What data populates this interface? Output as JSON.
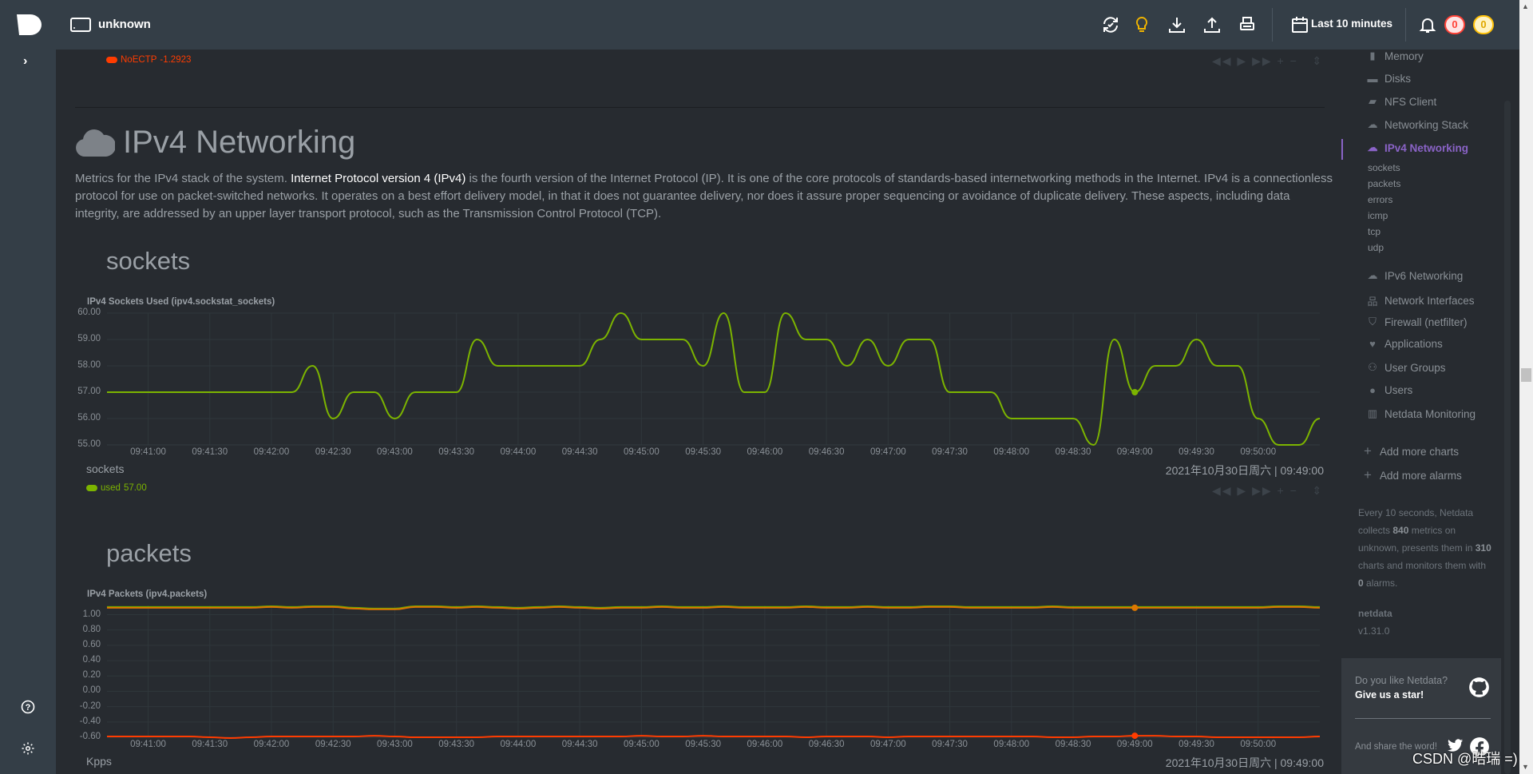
{
  "header": {
    "host": "unknown",
    "icons": [
      "netdata-logo",
      "server-icon",
      "refresh-icon",
      "lightbulb-icon",
      "download-icon",
      "upload-icon",
      "print-icon",
      "calendar-icon",
      "bell-icon"
    ],
    "time_range": "Last 10 minutes",
    "alarm_critical_count": "0",
    "alarm_warning_count": "0",
    "colors": {
      "bg": "#343e47",
      "critical": "#ff4136",
      "warning": "#ffc107"
    }
  },
  "prev_chart_legend": {
    "label": "NoECTP",
    "value": "-1.2923",
    "color": "#ff3c00"
  },
  "section": {
    "title": "IPv4 Networking",
    "icon": "cloud-icon",
    "desc_before": "Metrics for the IPv4 stack of the system. ",
    "desc_link": "Internet Protocol version 4 (IPv4)",
    "desc_after": " is the fourth version of the Internet Protocol (IP). It is one of the core protocols of standards-based internetworking methods in the Internet. IPv4 is a connectionless protocol for use on packet-switched networks. It operates on a best effort delivery model, in that it does not guarantee delivery, nor does it assure proper sequencing or avoidance of duplicate delivery. These aspects, including data integrity, are addressed by an upper layer transport protocol, such as the Transmission Control Protocol (TCP)."
  },
  "sockets_section": {
    "title": "sockets"
  },
  "packets_section": {
    "title": "packets"
  },
  "chart_data": [
    {
      "type": "line",
      "title": "IPv4 Sockets Used (ipv4.sockstat_sockets)",
      "ylabel": "sockets",
      "ylim": [
        55,
        60
      ],
      "yticks": [
        "60.00",
        "59.00",
        "58.00",
        "57.00",
        "56.00",
        "55.00"
      ],
      "xlim": [
        "09:40:40",
        "09:50:30"
      ],
      "xticks": [
        "09:41:00",
        "09:41:30",
        "09:42:00",
        "09:42:30",
        "09:43:00",
        "09:43:30",
        "09:44:00",
        "09:44:30",
        "09:45:00",
        "09:45:30",
        "09:46:00",
        "09:46:30",
        "09:47:00",
        "09:47:30",
        "09:48:00",
        "09:48:30",
        "09:49:00",
        "09:49:30",
        "09:50:00"
      ],
      "grid": true,
      "timestamp": "2021年10月30日周六 | 09:49:00",
      "highlight_time": "09:49:00",
      "series": [
        {
          "name": "used",
          "color": "#7cb400",
          "legend_value": "57.00",
          "values": [
            57,
            57,
            57,
            57,
            57,
            57,
            57,
            57,
            57,
            57,
            58,
            56,
            57,
            57,
            56,
            57,
            57,
            57,
            59,
            58,
            58,
            58,
            58,
            58,
            59,
            60,
            59,
            59,
            59,
            58,
            60,
            57,
            57,
            60,
            59,
            59,
            58,
            59,
            58,
            59,
            59,
            57,
            57,
            57,
            56,
            56,
            56,
            56,
            55,
            59,
            57,
            58,
            58,
            59,
            58,
            58,
            56,
            55,
            55,
            56
          ]
        }
      ]
    },
    {
      "type": "line",
      "title": "IPv4 Packets (ipv4.packets)",
      "ylabel": "Kpps",
      "ylim": [
        -0.6,
        1.12
      ],
      "yticks": [
        "1.00",
        "0.80",
        "0.60",
        "0.40",
        "0.20",
        "0.00",
        "-0.20",
        "-0.40",
        "-0.60"
      ],
      "xlim": [
        "09:40:40",
        "09:50:30"
      ],
      "xticks": [
        "09:41:00",
        "09:41:30",
        "09:42:00",
        "09:42:30",
        "09:43:00",
        "09:43:30",
        "09:44:00",
        "09:44:30",
        "09:45:00",
        "09:45:30",
        "09:46:00",
        "09:46:30",
        "09:47:00",
        "09:47:30",
        "09:48:00",
        "09:48:30",
        "09:49:00",
        "09:49:30",
        "09:50:00"
      ],
      "grid": true,
      "timestamp": "2021年10月30日周六 | 09:49:00",
      "highlight_time": "09:49:00",
      "series": [
        {
          "color": "#66aa00",
          "values": [
            1.1,
            1.1,
            1.1,
            1.1,
            1.1,
            1.1,
            1.1,
            1.1,
            1.11,
            1.1,
            1.11,
            1.11,
            1.09,
            1.08,
            1.08,
            1.11,
            1.11,
            1.1,
            1.11,
            1.1,
            1.09,
            1.1,
            1.11,
            1.1,
            1.09,
            1.1,
            1.1,
            1.11,
            1.1,
            1.1,
            1.11,
            1.1,
            1.1,
            1.1,
            1.11,
            1.1,
            1.1,
            1.11,
            1.1,
            1.1,
            1.11,
            1.11,
            1.1,
            1.1,
            1.1,
            1.1,
            1.11,
            1.1,
            1.1,
            1.1,
            1.1,
            1.1,
            1.1,
            1.1,
            1.1,
            1.1,
            1.1,
            1.11,
            1.11,
            1.1
          ]
        },
        {
          "color": "#dd7700",
          "values": [
            1.09,
            1.09,
            1.09,
            1.09,
            1.09,
            1.09,
            1.09,
            1.09,
            1.1,
            1.09,
            1.1,
            1.1,
            1.08,
            1.07,
            1.07,
            1.1,
            1.1,
            1.09,
            1.1,
            1.09,
            1.08,
            1.09,
            1.1,
            1.09,
            1.08,
            1.09,
            1.09,
            1.1,
            1.09,
            1.09,
            1.1,
            1.09,
            1.09,
            1.09,
            1.1,
            1.09,
            1.09,
            1.1,
            1.09,
            1.09,
            1.1,
            1.1,
            1.09,
            1.09,
            1.09,
            1.09,
            1.1,
            1.09,
            1.09,
            1.09,
            1.09,
            1.09,
            1.09,
            1.09,
            1.09,
            1.09,
            1.09,
            1.1,
            1.1,
            1.09
          ]
        },
        {
          "color": "#ff3c00",
          "values": [
            -0.59,
            -0.59,
            -0.59,
            -0.59,
            -0.59,
            -0.6,
            -0.61,
            -0.6,
            -0.59,
            -0.59,
            -0.59,
            -0.59,
            -0.59,
            -0.58,
            -0.59,
            -0.6,
            -0.6,
            -0.6,
            -0.6,
            -0.59,
            -0.59,
            -0.59,
            -0.59,
            -0.59,
            -0.59,
            -0.59,
            -0.58,
            -0.59,
            -0.59,
            -0.58,
            -0.59,
            -0.59,
            -0.59,
            -0.59,
            -0.6,
            -0.59,
            -0.59,
            -0.59,
            -0.6,
            -0.59,
            -0.59,
            -0.59,
            -0.59,
            -0.59,
            -0.59,
            -0.59,
            -0.6,
            -0.6,
            -0.59,
            -0.59,
            -0.58,
            -0.58,
            -0.59,
            -0.59,
            -0.6,
            -0.6,
            -0.6,
            -0.6,
            -0.6,
            -0.59
          ]
        }
      ]
    }
  ],
  "chart_controls": [
    "pan-left-icon",
    "play-icon",
    "pan-right-icon",
    "zoom-in-icon",
    "zoom-out-icon",
    "resize-icon"
  ],
  "right_nav": {
    "items": [
      {
        "label": "Memory",
        "icon": "memory-icon"
      },
      {
        "label": "Disks",
        "icon": "hdd-icon"
      },
      {
        "label": "NFS Client",
        "icon": "folder-open-icon"
      },
      {
        "label": "Networking Stack",
        "icon": "cloud-icon"
      },
      {
        "label": "IPv4 Networking",
        "icon": "cloud-icon",
        "active": true
      },
      {
        "label": "IPv6 Networking",
        "icon": "cloud-icon"
      },
      {
        "label": "Network Interfaces",
        "icon": "sitemap-icon"
      },
      {
        "label": "Firewall (netfilter)",
        "icon": "shield-icon"
      },
      {
        "label": "Applications",
        "icon": "heartbeat-icon"
      },
      {
        "label": "User Groups",
        "icon": "users-icon"
      },
      {
        "label": "Users",
        "icon": "user-icon"
      },
      {
        "label": "Netdata Monitoring",
        "icon": "bar-chart-icon"
      }
    ],
    "sub_items": [
      "sockets",
      "packets",
      "errors",
      "icmp",
      "tcp",
      "udp"
    ],
    "add_charts": "Add more charts",
    "add_alarms": "Add more alarms",
    "info": {
      "t1": "Every 10 seconds, Netdata collects ",
      "metrics": "840",
      "t2": " metrics on unknown, presents them in ",
      "charts": "310",
      "t3": " charts and monitors them with ",
      "alarms": "0",
      "t4": " alarms."
    },
    "product": "netdata",
    "version": "v1.31.0",
    "active_color": "#8a63c7"
  },
  "star_box": {
    "question": "Do you like Netdata?",
    "cta": "Give us a star!",
    "share": "And share the word!"
  },
  "watermark": "CSDN @晧瑞 =)"
}
